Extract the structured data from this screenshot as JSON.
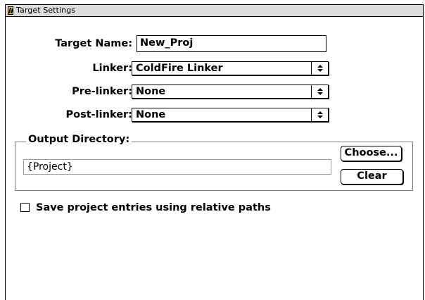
{
  "window": {
    "title": "Target Settings"
  },
  "form": {
    "target_name_label": "Target Name:",
    "target_name_value": "New_Proj",
    "linker_label": "Linker:",
    "linker_value": "ColdFire Linker",
    "prelinker_label": "Pre-linker:",
    "prelinker_value": "None",
    "postlinker_label": "Post-linker:",
    "postlinker_value": "None"
  },
  "output": {
    "group_label": "Output Directory:",
    "path_value": "{Project}",
    "choose_label": "Choose...",
    "clear_label": "Clear"
  },
  "options": {
    "relative_paths_label": "Save project entries using relative paths",
    "relative_paths_checked": false
  },
  "icons": {
    "app_icon": "codewarrior-icon",
    "popup_arrow": "up-down-arrows-icon",
    "checkbox": "checkbox-icon"
  },
  "colors": {
    "titlebar": "#dcdcdc",
    "app_icon": "#f3c400",
    "group_border": "#808080"
  }
}
